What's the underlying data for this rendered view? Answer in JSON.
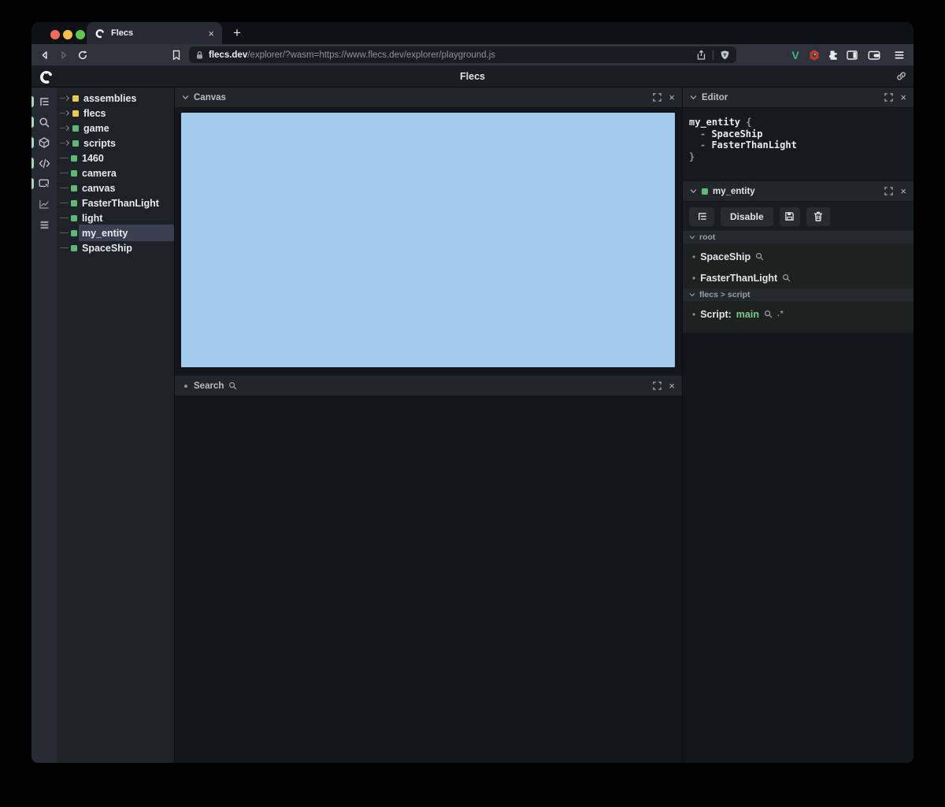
{
  "browser": {
    "traffic_lights": {
      "close": "#ec6a5e",
      "minimize": "#f4bf4f",
      "zoom": "#61c554"
    },
    "tab": {
      "title": "Flecs",
      "close_label": "×",
      "new_tab_label": "+"
    },
    "url": {
      "domain": "flecs.dev",
      "path": "/explorer/?wasm=https://www.flecs.dev/explorer/playground.js"
    }
  },
  "glyphs": {
    "close": "×",
    "bullet": "•"
  },
  "app": {
    "header": {
      "title": "Flecs"
    },
    "colors": {
      "module": "#e8c952",
      "entity": "#5fb878",
      "canvas": "#a3ccef",
      "selected_row": "#3a4050",
      "value_green": "#7cc98e",
      "indicator": "#a9d8b4"
    },
    "sidebar_icons": [
      {
        "name": "outliner-icon",
        "active": true
      },
      {
        "name": "search-icon",
        "active": true
      },
      {
        "name": "entities-icon",
        "active": true
      },
      {
        "name": "code-icon",
        "active": true
      },
      {
        "name": "canvas-select-icon",
        "active": true
      },
      {
        "name": "stats-icon",
        "active": false
      },
      {
        "name": "memory-icon",
        "active": false
      }
    ],
    "tree": {
      "items": [
        {
          "label": "assemblies",
          "type": "module",
          "expandable": true,
          "selected": false
        },
        {
          "label": "flecs",
          "type": "module",
          "expandable": true,
          "selected": false
        },
        {
          "label": "game",
          "type": "entity",
          "expandable": true,
          "selected": false
        },
        {
          "label": "scripts",
          "type": "entity",
          "expandable": true,
          "selected": false
        },
        {
          "label": "1460",
          "type": "entity",
          "expandable": false,
          "selected": false
        },
        {
          "label": "camera",
          "type": "entity",
          "expandable": false,
          "selected": false
        },
        {
          "label": "canvas",
          "type": "entity",
          "expandable": false,
          "selected": false
        },
        {
          "label": "FasterThanLight",
          "type": "entity",
          "expandable": false,
          "selected": false
        },
        {
          "label": "light",
          "type": "entity",
          "expandable": false,
          "selected": false
        },
        {
          "label": "my_entity",
          "type": "entity",
          "expandable": false,
          "selected": true
        },
        {
          "label": "SpaceShip",
          "type": "entity",
          "expandable": false,
          "selected": false
        }
      ]
    },
    "canvas_panel": {
      "title": "Canvas"
    },
    "search_panel": {
      "title": "Search"
    },
    "editor_panel": {
      "title": "Editor",
      "code": {
        "entity": "my_entity",
        "open_brace": "{",
        "close_brace": "}",
        "dash": "-",
        "components": [
          "SpaceShip",
          "FasterThanLight"
        ]
      }
    },
    "inspector": {
      "title": "my_entity",
      "disable_label": "Disable",
      "sections": [
        {
          "title": "root",
          "rows": [
            {
              "name": "SpaceShip"
            },
            {
              "name": "FasterThanLight"
            }
          ]
        },
        {
          "title": "flecs > script",
          "rows": [
            {
              "name": "Script:",
              "value": "main",
              "suffix": ".*"
            }
          ]
        }
      ]
    }
  }
}
